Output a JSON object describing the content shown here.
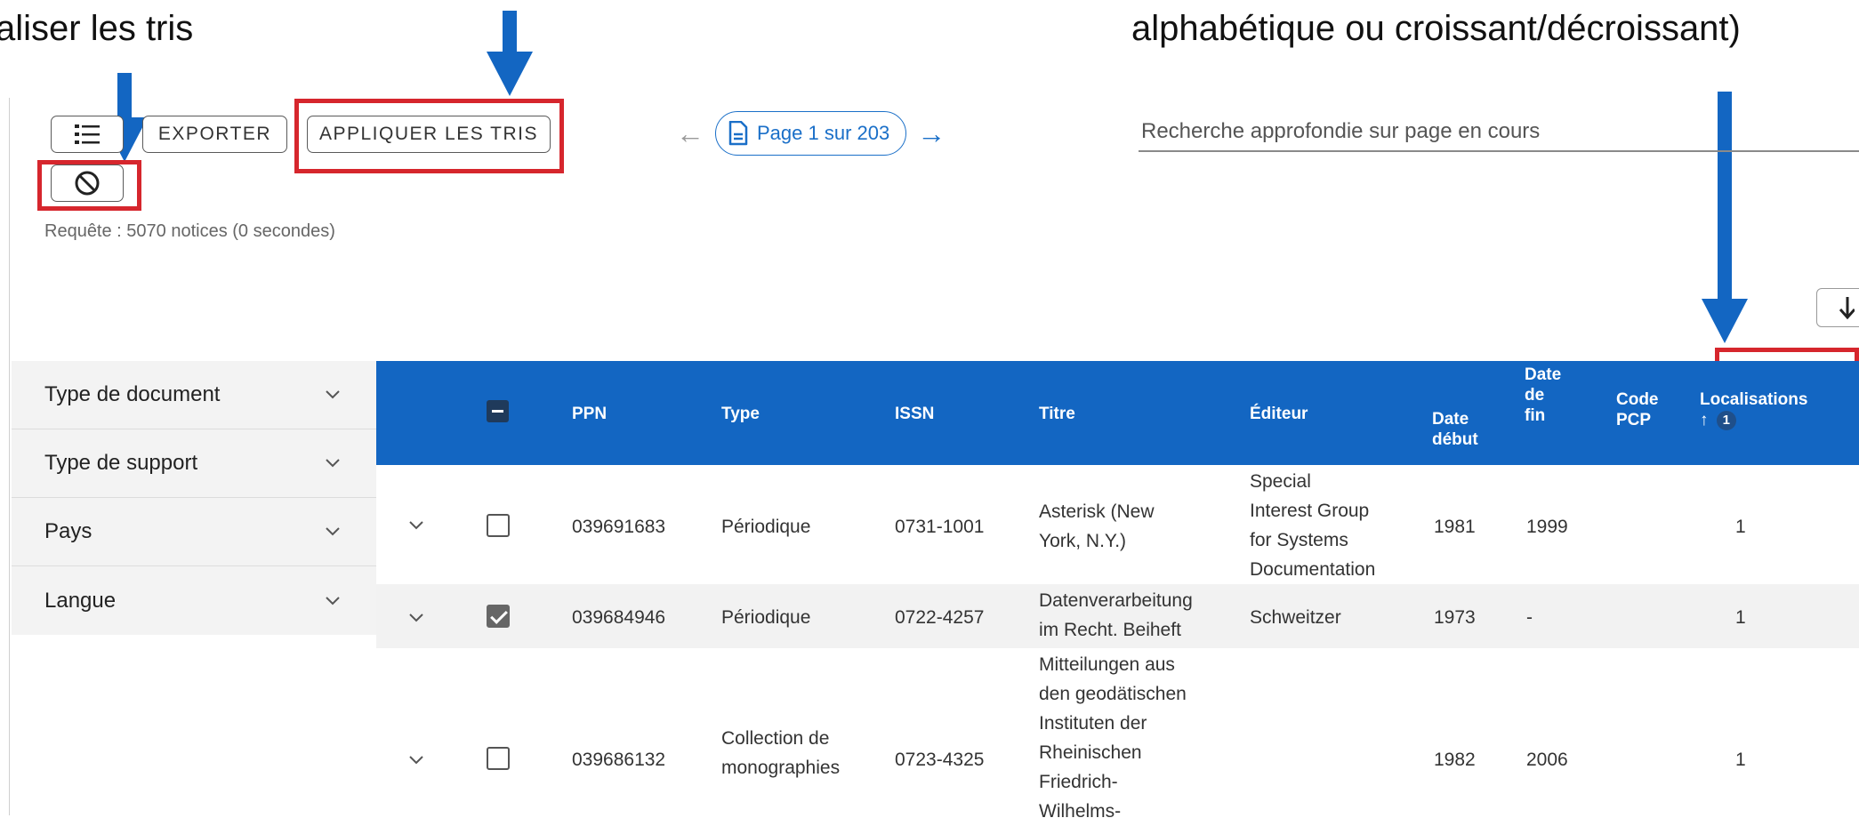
{
  "captions": {
    "left": "aliser les tris",
    "right": "alphabétique ou croissant/décroissant)"
  },
  "toolbar": {
    "list_icon": "list-icon",
    "export_label": "EXPORTER",
    "apply_sort_label": "APPLIQUER LES TRIS",
    "reset_icon": "prohibited-icon"
  },
  "pagination": {
    "prev": "←",
    "label": "Page 1 sur 203",
    "next": "→"
  },
  "search": {
    "placeholder": "Recherche approfondie sur page en cours"
  },
  "query_info": "Requête : 5070 notices (0 secondes)",
  "filters": [
    "Type de document",
    "Type de support",
    "Pays",
    "Langue"
  ],
  "table": {
    "columns": {
      "ppn": "PPN",
      "type": "Type",
      "issn": "ISSN",
      "titre": "Titre",
      "editeur": "Éditeur",
      "date_debut_1": "Date",
      "date_debut_2": "début",
      "date_fin_1": "Date",
      "date_fin_2": "de",
      "date_fin_3": "fin",
      "code_pcp_1": "Code",
      "code_pcp_2": "PCP",
      "localisations": "Localisations",
      "sort_arrow": "↑",
      "sort_order": "1"
    },
    "rows": [
      {
        "ppn": "039691683",
        "type": [
          "Périodique"
        ],
        "issn": "0731-1001",
        "titre": [
          "Asterisk (New",
          "York, N.Y.)"
        ],
        "editeur": [
          "Special",
          "Interest Group",
          "for Systems",
          "Documentation"
        ],
        "date_debut": "1981",
        "date_fin": "1999",
        "code_pcp": "",
        "localisations": "1",
        "checked": false
      },
      {
        "ppn": "039684946",
        "type": [
          "Périodique"
        ],
        "issn": "0722-4257",
        "titre": [
          "Datenverarbeitung",
          "im Recht. Beiheft"
        ],
        "editeur": [
          "Schweitzer"
        ],
        "date_debut": "1973",
        "date_fin": "-",
        "code_pcp": "",
        "localisations": "1",
        "checked": true
      },
      {
        "ppn": "039686132",
        "type": [
          "Collection de",
          "monographies"
        ],
        "issn": "0723-4325",
        "titre": [
          "Mitteilungen aus",
          "den geodätischen",
          "Instituten der",
          "Rheinischen",
          "Friedrich-",
          "Wilhelms-"
        ],
        "editeur": [],
        "date_debut": "1982",
        "date_fin": "2006",
        "code_pcp": "",
        "localisations": "1",
        "checked": false
      }
    ]
  },
  "colors": {
    "header_bg": "#1366c2",
    "annotation_arrow": "#1366c2",
    "annotation_box": "#d6262d",
    "link_blue": "#1a6fc8"
  }
}
